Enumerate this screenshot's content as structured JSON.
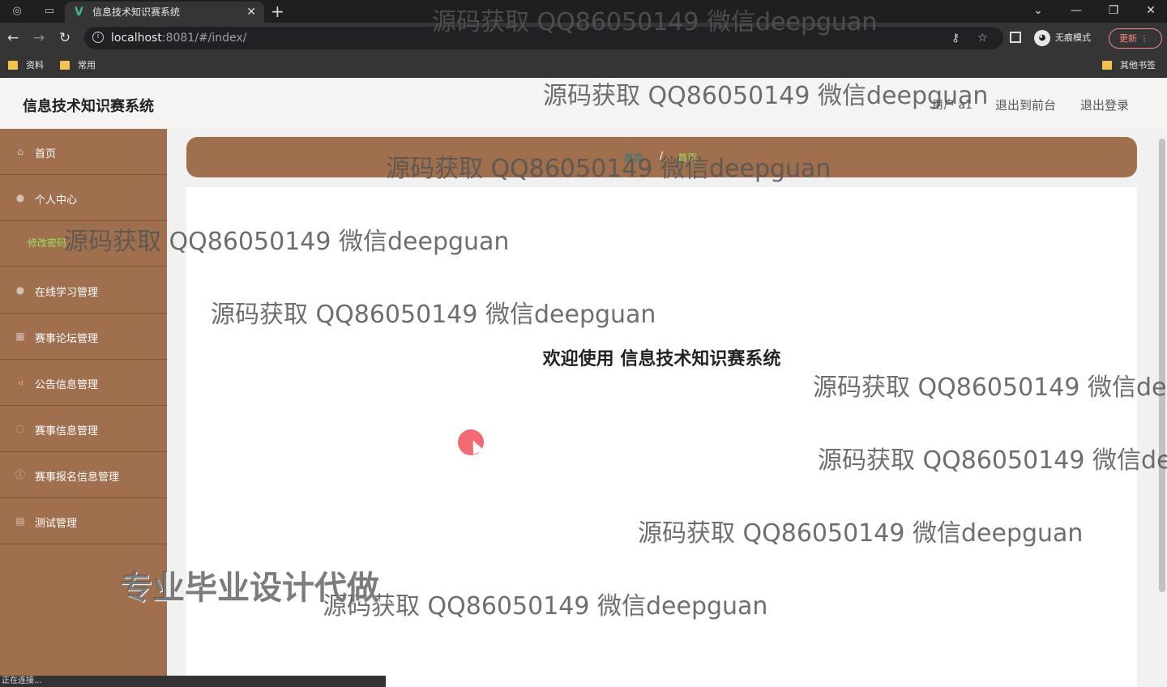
{
  "browser": {
    "tab_title": "信息技术知识赛系统",
    "url_host": "localhost",
    "url_rest": ":8081/#/index/",
    "incognito_label": "无痕模式",
    "update_label": "更新",
    "bookmarks": [
      "资料",
      "常用"
    ],
    "other_bookmarks": "其他书签",
    "status_text": "正在连接..."
  },
  "header": {
    "site_title": "信息技术知识赛系统",
    "user_label": "用户 a1",
    "back_to_front": "退出到前台",
    "logout": "退出登录"
  },
  "sidebar": {
    "items": [
      {
        "label": "首页",
        "icon": "home-icon"
      },
      {
        "label": "个人中心",
        "icon": "user-icon"
      },
      {
        "label": "在线学习管理",
        "icon": "person-icon"
      },
      {
        "label": "赛事论坛管理",
        "icon": "grid-icon"
      },
      {
        "label": "公告信息管理",
        "icon": "megaphone-icon"
      },
      {
        "label": "赛事信息管理",
        "icon": "message-icon"
      },
      {
        "label": "赛事报名信息管理",
        "icon": "info-icon"
      },
      {
        "label": "测试管理",
        "icon": "doc-icon"
      }
    ],
    "submenu_change_password": "修改密码"
  },
  "breadcrumb": {
    "home": "首页",
    "separator": "/",
    "current": "首页"
  },
  "main": {
    "welcome": "欢迎使用 信息技术知识赛系统"
  },
  "watermarks": {
    "text": "源码获取 QQ86050149 微信deepguan",
    "big_text": "专业毕业设计代做"
  },
  "colors": {
    "sidebar_bg": "#a06f4e",
    "accent_green": "#9be15d",
    "breadcrumb_link": "#1f7a8c"
  }
}
